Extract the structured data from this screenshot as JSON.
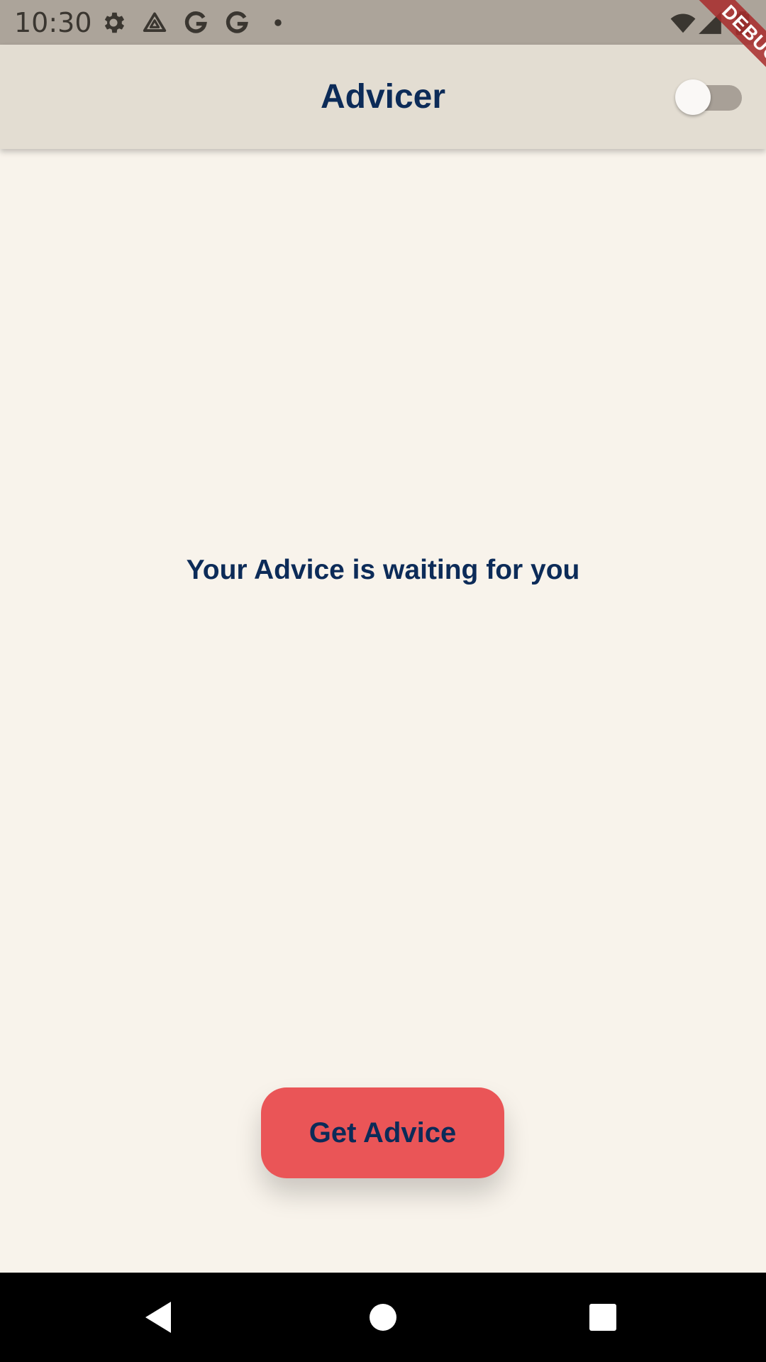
{
  "status_bar": {
    "time": "10:30",
    "left_icons": [
      "gear-icon",
      "drive-icon",
      "google-g-icon",
      "google-g-icon",
      "dot-icon"
    ],
    "right_icons": [
      "wifi-icon",
      "signal-icon",
      "battery-icon"
    ]
  },
  "app_bar": {
    "title": "Advicer",
    "theme_toggle": {
      "state": "off"
    }
  },
  "debug_banner": {
    "label": "DEBUG"
  },
  "main": {
    "message": "Your Advice is waiting for you"
  },
  "actions": {
    "get_advice_label": "Get Advice"
  },
  "nav_bar": {
    "buttons": [
      "back-icon",
      "home-icon",
      "recents-icon"
    ]
  },
  "colors": {
    "status_bar": "#aca49a",
    "app_bar": "#e3ddd2",
    "background": "#f8f3eb",
    "text": "#0c2b58",
    "button": "#ea5557",
    "debug": "#a82c2c",
    "nav_bar": "#000000"
  }
}
